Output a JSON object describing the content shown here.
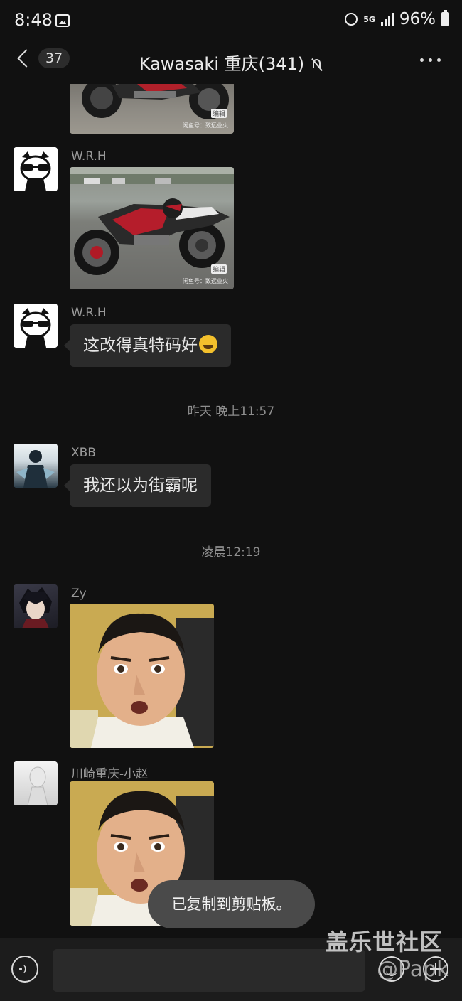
{
  "status_bar": {
    "time": "8:48",
    "network": "5G",
    "battery": "96%"
  },
  "nav": {
    "unread_count": "37",
    "title": "Kawasaki 重庆(341)"
  },
  "messages": [
    {
      "type": "image",
      "sender": "",
      "content": "motorcycle-photo"
    },
    {
      "type": "image",
      "sender": "W.R.H",
      "content": "motorcycle-photo"
    },
    {
      "type": "text",
      "sender": "W.R.H",
      "text": "这改得真特码好"
    },
    {
      "type": "text",
      "sender": "XBB",
      "text": "我还以为街霸呢"
    },
    {
      "type": "image",
      "sender": "Zy",
      "content": "meme-face"
    },
    {
      "type": "image",
      "sender": "川崎重庆-小赵",
      "content": "meme-face"
    }
  ],
  "timestamps": [
    "昨天 晚上11:57",
    "凌晨12:19"
  ],
  "image_tag": "编辑",
  "image_caption": "闲鱼号：致远业火",
  "toast": "已复制到剪贴板。",
  "watermark": {
    "line1": "盖乐世社区",
    "line2": "@Papk"
  },
  "colors": {
    "background": "#111111",
    "bubble": "#2b2b2b",
    "toast": "#4a4a4a",
    "input_bar": "#1c1c1c"
  }
}
